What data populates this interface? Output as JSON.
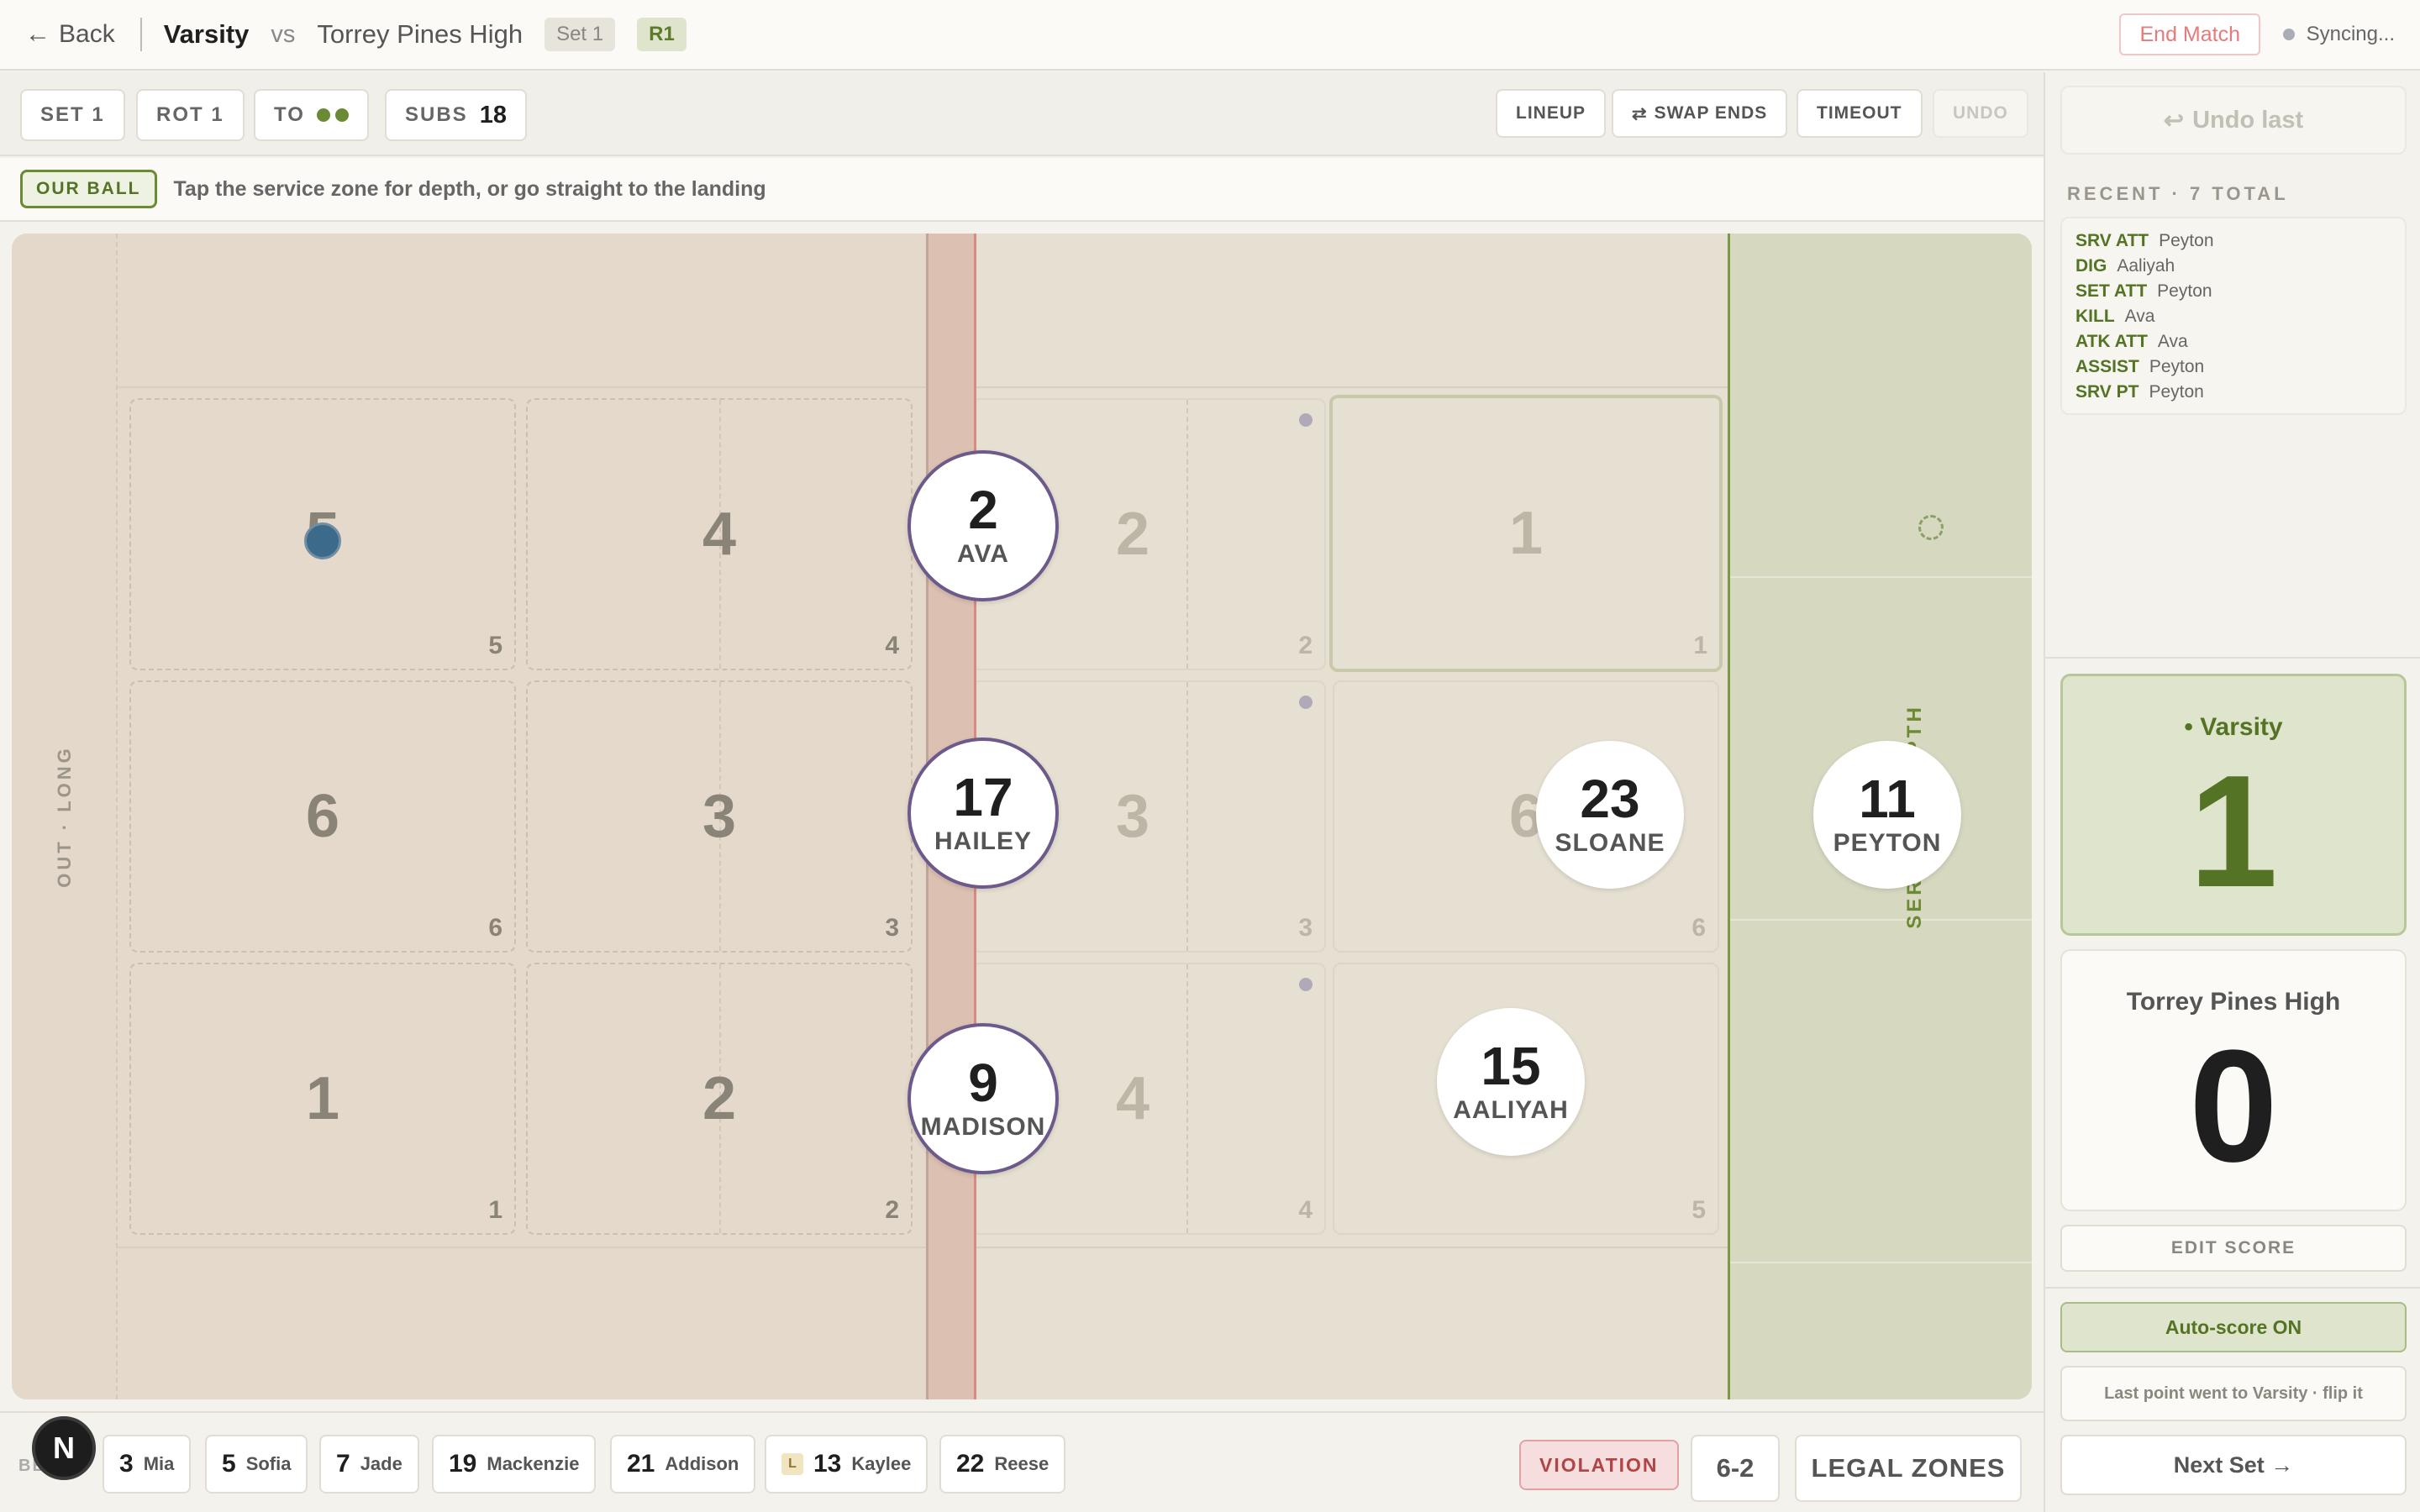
{
  "header": {
    "back_label": "Back",
    "home_team": "Varsity",
    "vs": "vs",
    "away_team": "Torrey Pines High",
    "set_pill": "Set 1",
    "rotation_pill": "R1",
    "end_match_label": "End Match",
    "sync_status": "Syncing..."
  },
  "toolbar": {
    "set_label": "SET 1",
    "rot_label": "ROT 1",
    "timeouts_label": "TO",
    "subs_label": "SUBS",
    "subs_value": "18",
    "buttons": {
      "lineup": "LINEUP",
      "swap_ends": "SWAP ENDS",
      "timeout": "TIMEOUT",
      "undo": "UNDO"
    }
  },
  "hint": {
    "badge": "OUR BALL",
    "text": "Tap the service zone for depth, or go straight to the landing"
  },
  "court": {
    "out_long_label": "OUT · LONG",
    "service_depth_label": "SERVICE · DEPTH",
    "opponent_zones": [
      {
        "big": "5",
        "small": "5"
      },
      {
        "big": "4",
        "small": "4"
      },
      {
        "big": "6",
        "small": "6"
      },
      {
        "big": "3",
        "small": "3"
      },
      {
        "big": "1",
        "small": "1"
      },
      {
        "big": "2",
        "small": "2"
      }
    ],
    "our_zones": [
      {
        "big": "2",
        "small": "2"
      },
      {
        "big": "1",
        "small": "1"
      },
      {
        "big": "3",
        "small": "3"
      },
      {
        "big": "6",
        "small": "6"
      },
      {
        "big": "4",
        "small": "4"
      },
      {
        "big": "",
        "small": "5"
      }
    ],
    "players": {
      "ava": {
        "number": "2",
        "name": "AVA"
      },
      "hailey": {
        "number": "17",
        "name": "HAILEY"
      },
      "madison": {
        "number": "9",
        "name": "MADISON"
      },
      "sloane": {
        "number": "23",
        "name": "SLOANE"
      },
      "aaliyah": {
        "number": "15",
        "name": "AALIYAH"
      },
      "peyton": {
        "number": "11",
        "name": "PEYTON"
      }
    }
  },
  "bench": {
    "label": "BENCH",
    "players": [
      {
        "number": "3",
        "name": "Mia"
      },
      {
        "number": "5",
        "name": "Sofia"
      },
      {
        "number": "7",
        "name": "Jade"
      },
      {
        "number": "19",
        "name": "Mackenzie"
      },
      {
        "number": "21",
        "name": "Addison"
      },
      {
        "number": "13",
        "name": "Kaylee",
        "libero": "L"
      },
      {
        "number": "22",
        "name": "Reese"
      }
    ],
    "violation_label": "VIOLATION",
    "formation_label": "6-2",
    "legal_zones_label": "LEGAL ZONES",
    "fab_label": "N"
  },
  "sidebar": {
    "undo_last_label": "Undo last",
    "recent_title": "RECENT · 7 TOTAL",
    "recent": [
      {
        "action": "SRV ATT",
        "player": "Peyton"
      },
      {
        "action": "DIG",
        "player": "Aaliyah"
      },
      {
        "action": "SET ATT",
        "player": "Peyton"
      },
      {
        "action": "KILL",
        "player": "Ava"
      },
      {
        "action": "ATK ATT",
        "player": "Ava"
      },
      {
        "action": "ASSIST",
        "player": "Peyton"
      },
      {
        "action": "SRV PT",
        "player": "Peyton"
      }
    ],
    "home_score": {
      "team": "Varsity",
      "score": "1"
    },
    "away_score": {
      "team": "Torrey Pines High",
      "score": "0"
    },
    "edit_score_label": "EDIT SCORE",
    "autoscore_label": "Auto-score ON",
    "flip_label": "Last point went to Varsity · flip it",
    "next_set_label": "Next Set →"
  },
  "colors": {
    "accent_green": "#557325",
    "net_red": "#d98a82",
    "player_ring": "#6c5a8c",
    "violation_red": "#b14444"
  }
}
